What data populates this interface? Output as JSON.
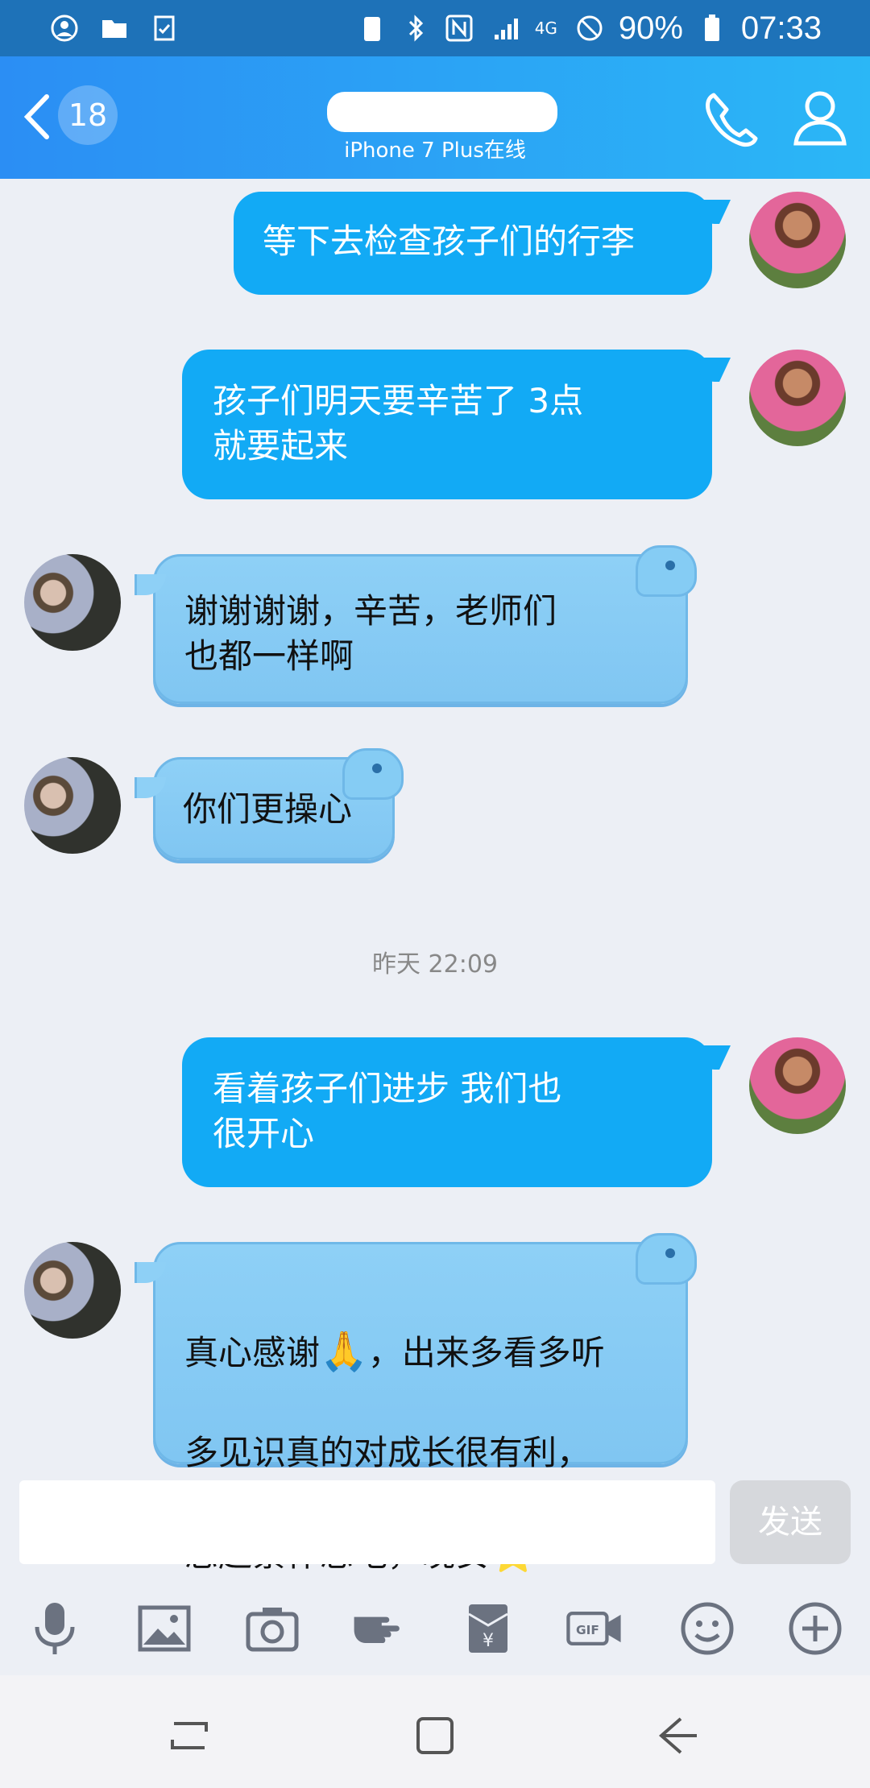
{
  "status_bar": {
    "battery": "90%",
    "time": "07:33",
    "network": "4G"
  },
  "header": {
    "unread_count": "18",
    "contact_status": "iPhone 7 Plus在线"
  },
  "messages": [
    {
      "side": "me",
      "text": "等下去检查孩子们的行李"
    },
    {
      "side": "me",
      "text": "孩子们明天要辛苦了  3点\n就要起来"
    },
    {
      "side": "them",
      "text": "谢谢谢谢，辛苦，老师们\n也都一样啊"
    },
    {
      "side": "them",
      "text": "你们更操心"
    },
    {
      "side": "me",
      "text": "看着孩子们进步 我们也\n很开心"
    },
    {
      "side": "them",
      "text_line1_a": "真心感谢",
      "emoji_1": "🙏",
      "text_line1_b": "，出来多看多听",
      "text_line2": "多见识真的对成长很有利，",
      "text_line3": "您赶紧休息吧，晚安",
      "emoji_2": "⭐"
    }
  ],
  "time_divider": "昨天 22:09",
  "input": {
    "placeholder": "",
    "send_label": "发送"
  },
  "toolbar": {
    "items": [
      "mic-icon",
      "image-icon",
      "camera-icon",
      "poke-icon",
      "red-packet-icon",
      "gif-icon",
      "emoji-icon",
      "plus-icon"
    ]
  },
  "colors": {
    "accent": "#2b8ef4",
    "my_bubble": "#12aaf5",
    "their_bubble": "#8ed0f6"
  }
}
